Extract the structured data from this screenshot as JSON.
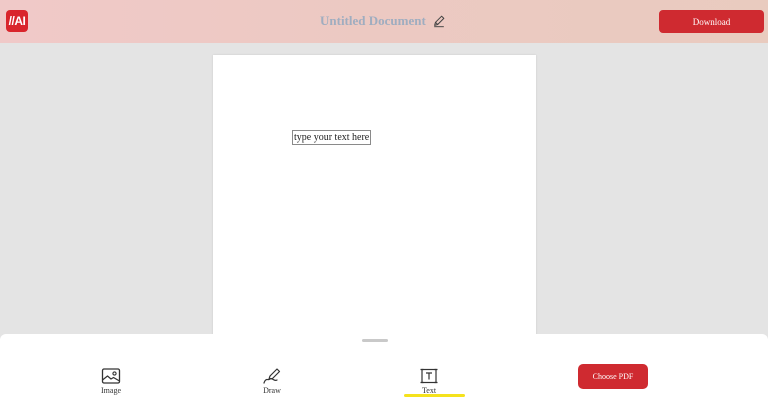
{
  "header": {
    "logo_text": "//AI",
    "title": "Untitled Document",
    "download_label": "Download"
  },
  "document": {
    "text_field_value": "type your text here"
  },
  "toolbar": {
    "tools": [
      {
        "label": "Image",
        "icon": "image-icon"
      },
      {
        "label": "Draw",
        "icon": "draw-icon"
      },
      {
        "label": "Text",
        "icon": "text-icon",
        "active": true
      }
    ],
    "choose_pdf_label": "Choose PDF"
  },
  "colors": {
    "accent": "#cf2a30",
    "active_indicator": "#f5e21c",
    "title": "#9fadc0"
  }
}
